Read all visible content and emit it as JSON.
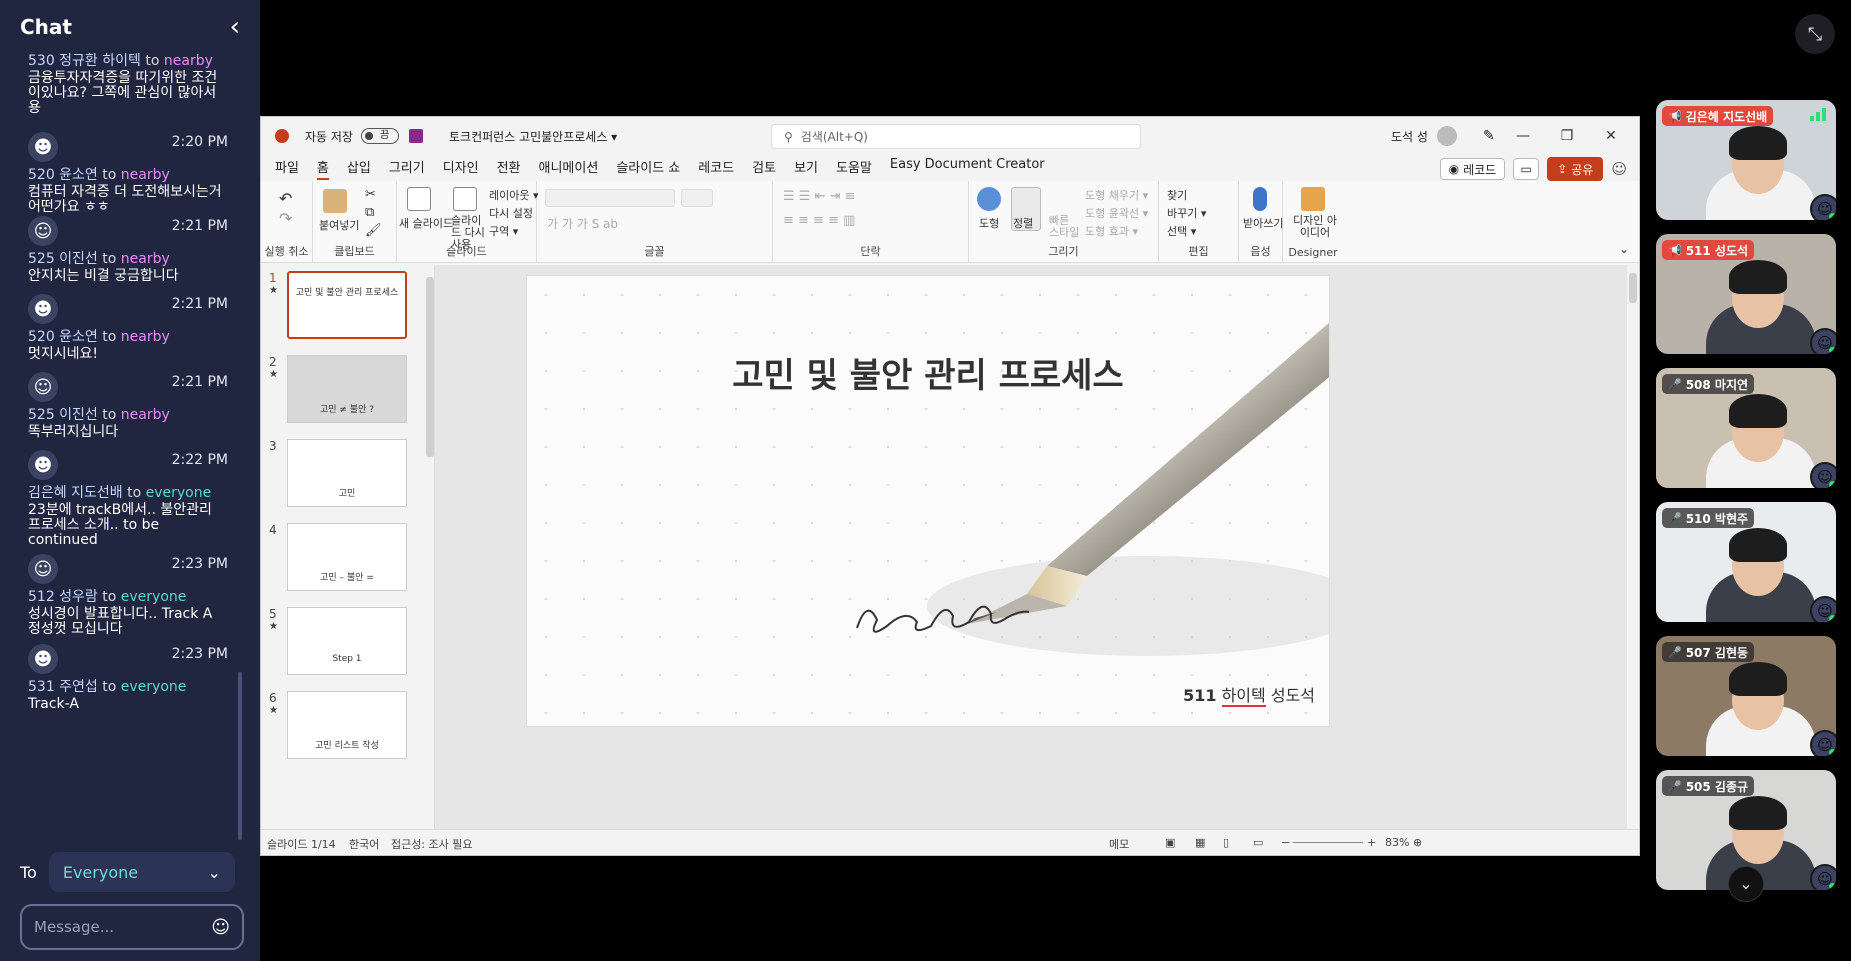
{
  "chat": {
    "title": "Chat",
    "to_label": "To",
    "to_value": "Everyone",
    "message_placeholder": "Message...",
    "messages": [
      {
        "time": "",
        "sender": "530 정규환 하이텍",
        "to_word": "to",
        "target": "nearby",
        "text": "금융투자자격증을 따기위한 조건이있나요? 그쪽에 관심이 많아서용"
      },
      {
        "time": "2:20 PM",
        "sender": "520 윤소연",
        "to_word": "to",
        "target": "nearby",
        "text": "컴퓨터 자격증 더 도전해보시는거 어떤가요 ㅎㅎ"
      },
      {
        "time": "2:21 PM",
        "sender": "525 이진선",
        "to_word": "to",
        "target": "nearby",
        "text": "안지치는 비결 궁금합니다"
      },
      {
        "time": "2:21 PM",
        "sender": "520 윤소연",
        "to_word": "to",
        "target": "nearby",
        "text": "멋지시네요!"
      },
      {
        "time": "2:21 PM",
        "sender": "525 이진선",
        "to_word": "to",
        "target": "nearby",
        "text": "똑부러지십니다"
      },
      {
        "time": "2:22 PM",
        "sender": "김은혜 지도선배",
        "to_word": "to",
        "target": "everyone",
        "text": "23분에 trackB에서.. 불안관리 프로세스 소개.. to be continued"
      },
      {
        "time": "2:23 PM",
        "sender": "512 성우람",
        "to_word": "to",
        "target": "everyone",
        "text": "성시경이 발표합니다.. Track A 정성껏 모십니다"
      },
      {
        "time": "2:23 PM",
        "sender": "531 주연섭",
        "to_word": "to",
        "target": "everyone",
        "text": "Track-A"
      }
    ]
  },
  "ppt": {
    "autosave": "자동 저장",
    "autosave_state": "끔",
    "doc_name": "토크컨퍼런스 고민불안프로세스 ▾",
    "search_placeholder": "검색(Alt+Q)",
    "user": "도석 성",
    "menu": [
      "파일",
      "홈",
      "삽입",
      "그리기",
      "디자인",
      "전환",
      "애니메이션",
      "슬라이드 쇼",
      "레코드",
      "검토",
      "보기",
      "도움말",
      "Easy Document Creator"
    ],
    "record_btn": "레코드",
    "share_btn": "공유",
    "ribbon": {
      "groups": [
        "실행 취소",
        "클립보드",
        "슬라이드",
        "글꼴",
        "단락",
        "그리기",
        "편집",
        "음성",
        "Designer"
      ],
      "paste": "붙여넣기",
      "new_slide": "새 슬라이드",
      "reuse_slide": "슬라이드 다시 사용",
      "layout": "레이아웃 ▾",
      "reset": "다시 설정",
      "section": "구역 ▾",
      "shapes": "도형",
      "arrange": "정렬",
      "quick_styles": "빠른 스타일",
      "shape_fill": "도형 채우기 ▾",
      "shape_outline": "도형 윤곽선 ▾",
      "shape_effects": "도형 효과 ▾",
      "find": "찾기",
      "replace": "바꾸기 ▾",
      "select": "선택 ▾",
      "dictate": "받아쓰기",
      "designer": "디자인 아이디어"
    },
    "thumbs": [
      {
        "num": "1",
        "star": "★",
        "text": "고민 및 불안 관리 프로세스"
      },
      {
        "num": "2",
        "star": "★",
        "text": "고민 ≠ 불안 ?"
      },
      {
        "num": "3",
        "star": "",
        "text": "고민"
      },
      {
        "num": "4",
        "star": "",
        "text": "고민 – 불안 = "
      },
      {
        "num": "5",
        "star": "★",
        "text": "Step 1"
      },
      {
        "num": "6",
        "star": "★",
        "text": "고민 리스트 작성"
      }
    ],
    "slide": {
      "title": "고민 및 불안 관리 프로세스",
      "author_num": "511",
      "author_name": "하이텍",
      "author_last": "성도석",
      "script_word": "hello"
    },
    "status": {
      "slide_counter": "슬라이드 1/14",
      "language": "한국어",
      "accessibility": "접근성: 조사 필요",
      "notes": "메모",
      "zoom": "83%"
    }
  },
  "participants": [
    {
      "name": "김은혜 지도선배",
      "state": "speaking",
      "bg": "#cfd4d8"
    },
    {
      "name": "511 성도석",
      "state": "speaking",
      "bg": "#b9b2a8"
    },
    {
      "name": "508 마지연",
      "state": "muted",
      "bg": "#c9c0b2"
    },
    {
      "name": "510 박현주",
      "state": "muted",
      "bg": "#e9ecef"
    },
    {
      "name": "507 김현동",
      "state": "muted",
      "bg": "#8c7a64"
    },
    {
      "name": "505 김종규",
      "state": "muted",
      "bg": "#d7d7d5"
    }
  ]
}
